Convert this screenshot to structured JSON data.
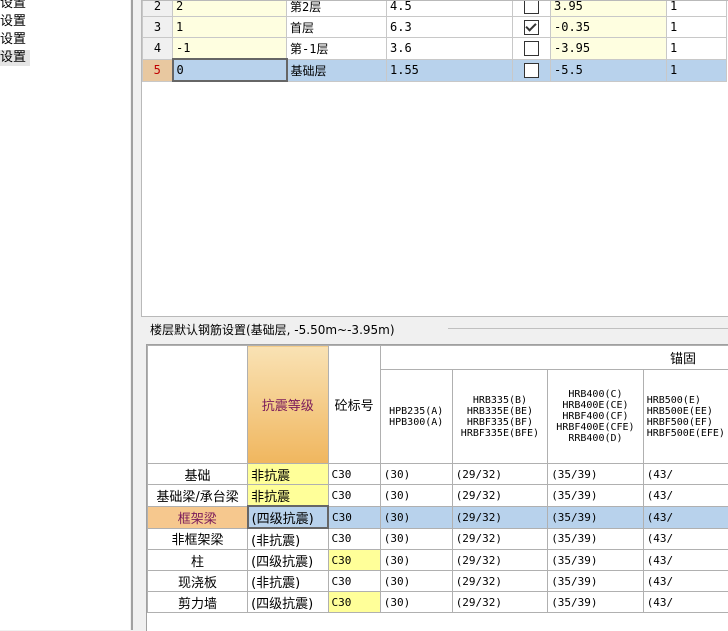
{
  "left_tree": {
    "items": [
      {
        "label": "设置",
        "selected": false
      },
      {
        "label": "设置",
        "selected": false
      },
      {
        "label": "设置",
        "selected": false
      },
      {
        "label": "设置",
        "selected": true
      }
    ]
  },
  "floors": {
    "rows": [
      {
        "num": "2",
        "code": "2",
        "name": "第2层",
        "height": "4.5",
        "checked": false,
        "elev": "3.95",
        "count": "1"
      },
      {
        "num": "3",
        "code": "1",
        "name": "首层",
        "height": "6.3",
        "checked": true,
        "elev": "-0.35",
        "count": "1"
      },
      {
        "num": "4",
        "code": "-1",
        "name": "第-1层",
        "height": "3.6",
        "checked": false,
        "elev": "-3.95",
        "count": "1"
      },
      {
        "num": "5",
        "code": "0",
        "name": "基础层",
        "height": "1.55",
        "checked": false,
        "elev": "-5.5",
        "count": "1"
      }
    ],
    "selected_index": 3
  },
  "rebar_settings": {
    "group_title": "楼层默认钢筋设置(基础层, -5.50m~-3.95m)",
    "headers": {
      "seismic": "抗震等级",
      "concrete": "砼标号",
      "anchor_group": "锚固",
      "steel": [
        "HPB235(A)\nHPB300(A)",
        "HRB335(B)\nHRB335E(BE)\nHRBF335(BF)\nHRBF335E(BFE)",
        "HRB400(C)\nHRB400E(CE)\nHRBF400(CF)\nHRBF400E(CFE)\nRRB400(D)",
        "HRB500(E)\nHRB500E(EE)\nHRBF500(EF)\nHRBF500E(EFE)"
      ]
    },
    "rows": [
      {
        "name": "基础",
        "seismic": "非抗震",
        "seismic_yellow": true,
        "concrete": "C30",
        "concrete_yellow": false,
        "v1": "(30)",
        "v2": "(29/32)",
        "v3": "(35/39)",
        "v4": "(43/"
      },
      {
        "name": "基础梁/承台梁",
        "seismic": "非抗震",
        "seismic_yellow": true,
        "concrete": "C30",
        "concrete_yellow": false,
        "v1": "(30)",
        "v2": "(29/32)",
        "v3": "(35/39)",
        "v4": "(43/"
      },
      {
        "name": "框架梁",
        "seismic": "(四级抗震)",
        "seismic_yellow": false,
        "concrete": "C30",
        "concrete_yellow": false,
        "v1": "(30)",
        "v2": "(29/32)",
        "v3": "(35/39)",
        "v4": "(43/",
        "selected": true
      },
      {
        "name": "非框架梁",
        "seismic": "(非抗震)",
        "seismic_yellow": false,
        "concrete": "C30",
        "concrete_yellow": false,
        "v1": "(30)",
        "v2": "(29/32)",
        "v3": "(35/39)",
        "v4": "(43/"
      },
      {
        "name": "柱",
        "seismic": "(四级抗震)",
        "seismic_yellow": false,
        "concrete": "C30",
        "concrete_yellow": true,
        "v1": "(30)",
        "v2": "(29/32)",
        "v3": "(35/39)",
        "v4": "(43/"
      },
      {
        "name": "现浇板",
        "seismic": "(非抗震)",
        "seismic_yellow": false,
        "concrete": "C30",
        "concrete_yellow": false,
        "v1": "(30)",
        "v2": "(29/32)",
        "v3": "(35/39)",
        "v4": "(43/"
      },
      {
        "name": "剪力墙",
        "seismic": "(四级抗震)",
        "seismic_yellow": false,
        "concrete": "C30",
        "concrete_yellow": true,
        "v1": "(30)",
        "v2": "(29/32)",
        "v3": "(35/39)",
        "v4": "(43/"
      }
    ]
  },
  "colors": {
    "selection": "#b8d2ec",
    "highlight_yellow": "#ffff99",
    "seismic_header": "#f0b65e"
  }
}
